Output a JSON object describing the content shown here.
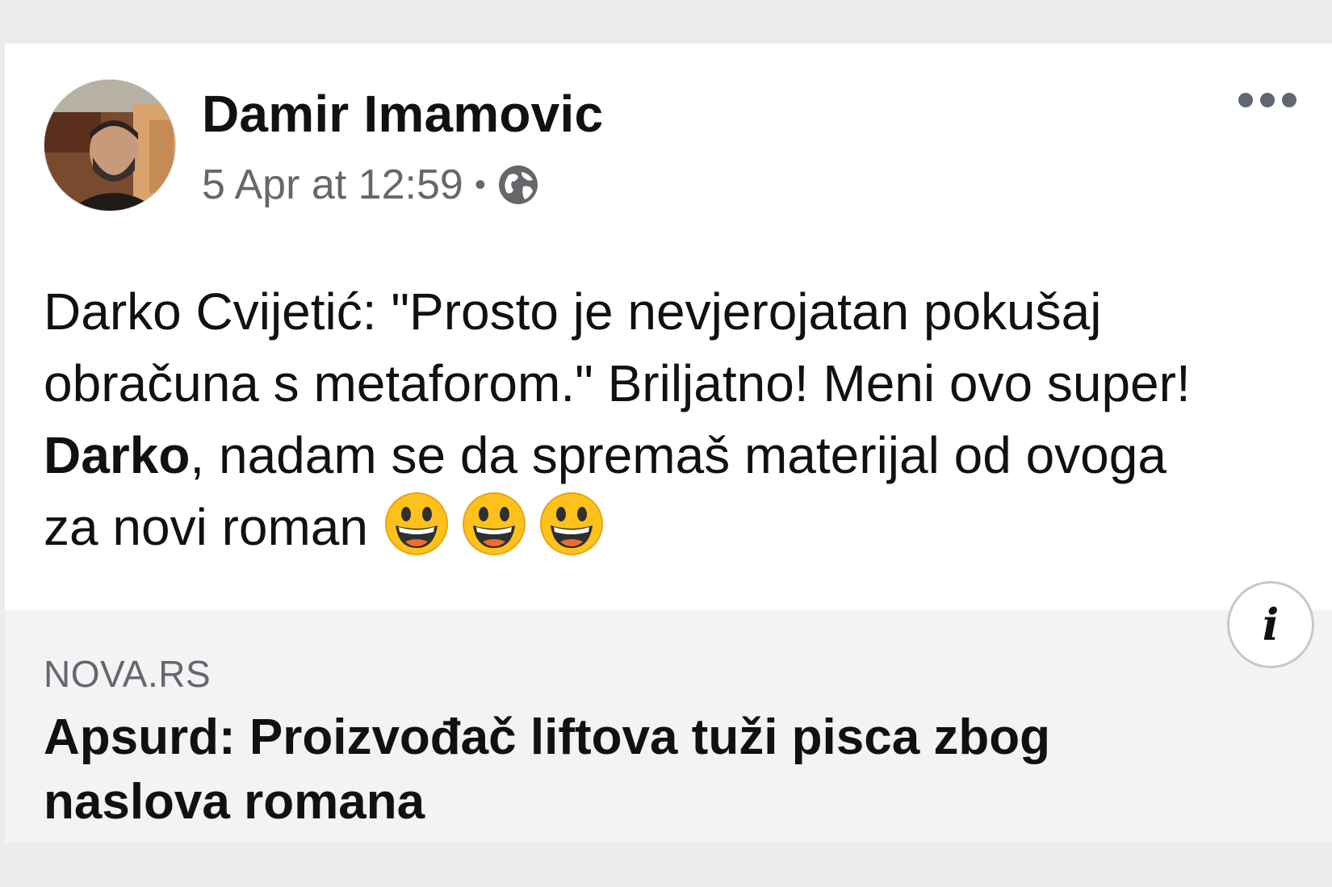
{
  "post": {
    "author": "Damir Imamovic",
    "timestamp": "5 Apr at 12:59",
    "separator": "•",
    "privacy_icon": "globe-icon",
    "more_icon": "more-options-icon",
    "text_lines": {
      "line1": "Darko Cvijetić: \"Prosto je nevjerojatan pokušaj",
      "line2": "obračuna s metaforom.\" Briljatno! Meni ovo super!",
      "line3_mention": "Darko",
      "line3_rest": ", nadam se da spremaš materijal od ovoga",
      "line4": "za novi roman"
    },
    "emoji": "grinning-face-emoji"
  },
  "link": {
    "domain": "NOVA.RS",
    "headline_line1": "Apsurd: Proizvođač liftova tuži pisca zbog",
    "headline_line2": "naslova romana",
    "info_label": "i"
  },
  "colors": {
    "background": "#ececec",
    "card": "#ffffff",
    "secondary_text": "#65676b",
    "preview_background": "#f2f3f5"
  }
}
